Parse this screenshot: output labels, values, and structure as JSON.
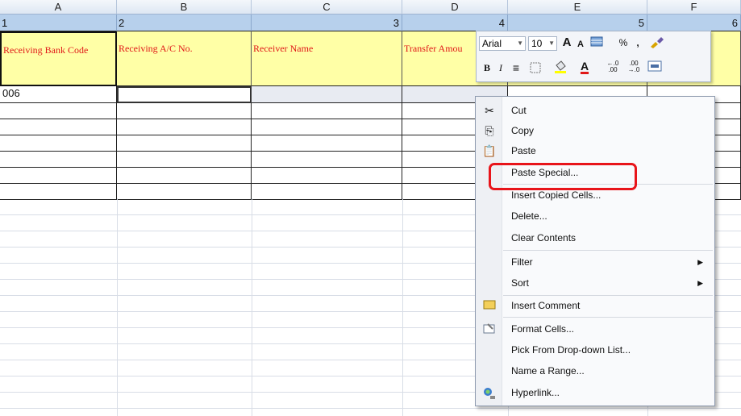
{
  "columns": [
    "A",
    "B",
    "C",
    "D",
    "E",
    "F"
  ],
  "number_row": [
    "1",
    "2",
    "3",
    "4",
    "5",
    "6"
  ],
  "headers": [
    "Receiving Bank Code",
    "Receiving A/C No.",
    "Receiver Name",
    "Transfer Amou"
  ],
  "first_data_cell": "006",
  "mini_toolbar": {
    "font": "Arial",
    "size": "10",
    "grow_font": "A",
    "shrink_font": "A",
    "percent": "%",
    "comma": ",",
    "bold": "B",
    "italic": "I",
    "align": "≡",
    "font_color": "A",
    "increase_decimal": "←.0\n.00",
    "decrease_decimal": ".00\n→.0"
  },
  "context_menu": {
    "items": [
      "Cut",
      "Copy",
      "Paste",
      "Paste Special...",
      "Insert Copied Cells...",
      "Delete...",
      "Clear Contents",
      "Filter",
      "Sort",
      "Insert Comment",
      "Format Cells...",
      "Pick From Drop-down List...",
      "Name a Range...",
      "Hyperlink..."
    ]
  },
  "colors": {
    "header_fill": "#ffffa6",
    "header_text": "#e01818",
    "num_row": "#b7d0ec",
    "highlight": "#e8141a"
  },
  "icons": [
    "scissors-icon",
    "copy-icon",
    "paste-icon",
    "comment-icon",
    "format-cells-icon",
    "hyperlink-icon"
  ]
}
